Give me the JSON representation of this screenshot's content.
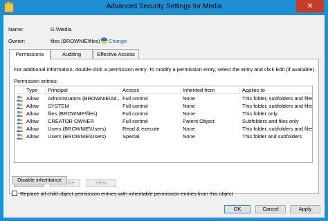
{
  "window": {
    "title": "Advanced Security Settings for Media",
    "close_glyph": "✕"
  },
  "info": {
    "name_label": "Name:",
    "name_value": "G:\\Media",
    "owner_label": "Owner:",
    "owner_value": "files (BROWNIE\\files)",
    "change_link": "Change"
  },
  "tabs": [
    {
      "label": "Permissions"
    },
    {
      "label": "Auditing"
    },
    {
      "label": "Effective Access"
    }
  ],
  "permissions": {
    "intro_text": "For additional information, double-click a permission entry. To modify a permission entry, select the entry and click Edit (if available).",
    "entries_label": "Permission entries:",
    "columns": {
      "type": "Type",
      "principal": "Principal",
      "access": "Access",
      "inherited_from": "Inherited from",
      "applies_to": "Applies to"
    },
    "rows": [
      {
        "type": "Allow",
        "principal": "Administrators (BROWNIE\\Ad...",
        "access": "Full control",
        "inherited_from": "None",
        "applies_to": "This folder, subfolders and files"
      },
      {
        "type": "Allow",
        "principal": "SYSTEM",
        "access": "Full control",
        "inherited_from": "None",
        "applies_to": "This folder, subfolders and files"
      },
      {
        "type": "Allow",
        "principal": "files (BROWNIE\\files)",
        "access": "Full control",
        "inherited_from": "None",
        "applies_to": "This folder only"
      },
      {
        "type": "Allow",
        "principal": "CREATOR OWNER",
        "access": "Full control",
        "inherited_from": "Parent Object",
        "applies_to": "Subfolders and files only"
      },
      {
        "type": "Allow",
        "principal": "Users (BROWNIE\\Users)",
        "access": "Read & execute",
        "inherited_from": "None",
        "applies_to": "This folder, subfolders and files"
      },
      {
        "type": "Allow",
        "principal": "Users (BROWNIE\\Users)",
        "access": "Special",
        "inherited_from": "None",
        "applies_to": "This folder and subfolders"
      }
    ],
    "add_button": "Add",
    "remove_button": "Remove",
    "view_button": "View",
    "disable_inheritance_button": "Disable inheritance",
    "replace_checkbox_label": "Replace all child object permission entries with inheritable permission entries from this object",
    "replace_checked": false
  },
  "footer": {
    "ok": "OK",
    "cancel": "Cancel",
    "apply": "Apply"
  },
  "colors": {
    "window_frame": "#1f8fd3",
    "close_button": "#c7392b",
    "link": "#1a5fb4",
    "dialog_bg": "#f0f0f0"
  }
}
